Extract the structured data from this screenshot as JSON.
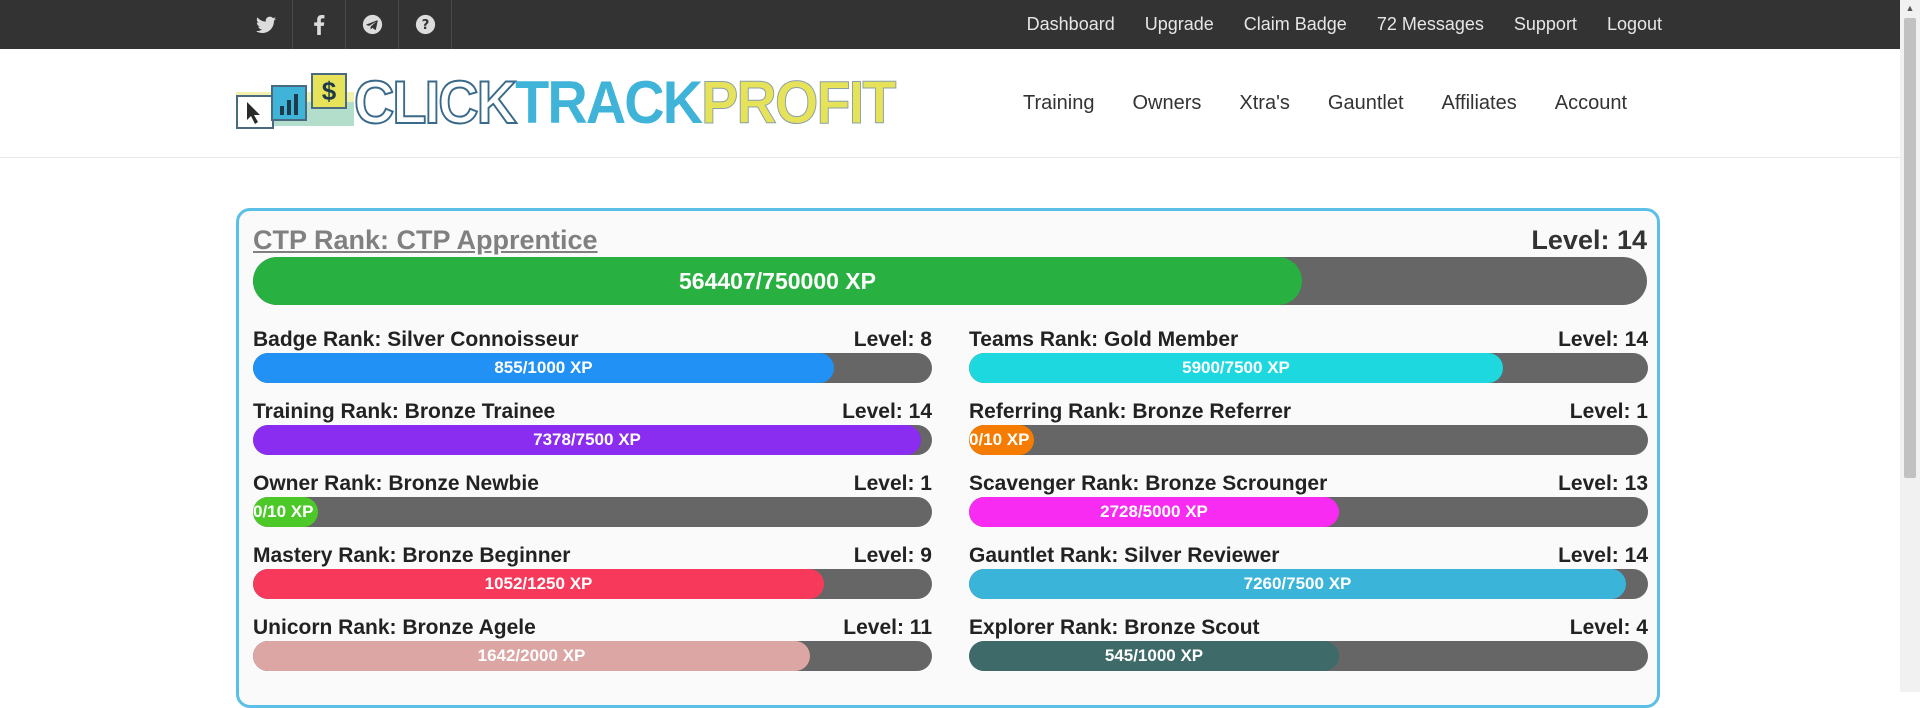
{
  "topbar": {
    "social_icons": [
      "twitter-icon",
      "facebook-icon",
      "telegram-icon",
      "help-icon"
    ],
    "nav": [
      "Dashboard",
      "Upgrade",
      "Claim Badge",
      "72 Messages",
      "Support",
      "Logout"
    ]
  },
  "header": {
    "logo": {
      "part1": "CLICK",
      "part2": "TRACK",
      "part3": "PROFIT"
    },
    "nav": [
      "Training",
      "Owners",
      "Xtra's",
      "Gauntlet",
      "Affiliates",
      "Account"
    ]
  },
  "ctp_rank": {
    "title": "CTP Rank: CTP Apprentice",
    "level": "Level: 14",
    "xp_text": "564407/750000 XP",
    "progress": 0.7525,
    "color": "#28b040"
  },
  "ranks": [
    {
      "name": "Badge Rank: Silver Connoisseur",
      "level": "Level: 8",
      "xp_text": "855/1000 XP",
      "progress": 0.855,
      "color": "#2191f5",
      "column": "left"
    },
    {
      "name": "Teams Rank: Gold Member",
      "level": "Level: 14",
      "xp_text": "5900/7500 XP",
      "progress": 0.787,
      "color": "#1ed8e0",
      "column": "right"
    },
    {
      "name": "Training Rank: Bronze Trainee",
      "level": "Level: 14",
      "xp_text": "7378/7500 XP",
      "progress": 0.984,
      "color": "#8a2df0",
      "column": "left"
    },
    {
      "name": "Referring Rank: Bronze Referrer",
      "level": "Level: 1",
      "xp_text": "0/10 XP",
      "progress": 0.0,
      "color": "#f57c00",
      "column": "right"
    },
    {
      "name": "Owner Rank: Bronze Newbie",
      "level": "Level: 1",
      "xp_text": "0/10 XP",
      "progress": 0.0,
      "color": "#4cc828",
      "column": "left"
    },
    {
      "name": "Scavenger Rank: Bronze Scrounger",
      "level": "Level: 13",
      "xp_text": "2728/5000 XP",
      "progress": 0.5456,
      "color": "#f82bf2",
      "column": "right"
    },
    {
      "name": "Mastery Rank: Bronze Beginner",
      "level": "Level: 9",
      "xp_text": "1052/1250 XP",
      "progress": 0.8416,
      "color": "#f73a5c",
      "column": "left"
    },
    {
      "name": "Gauntlet Rank: Silver Reviewer",
      "level": "Level: 14",
      "xp_text": "7260/7500 XP",
      "progress": 0.968,
      "color": "#3ab4d8",
      "column": "right"
    },
    {
      "name": "Unicorn Rank: Bronze Agele",
      "level": "Level: 11",
      "xp_text": "1642/2000 XP",
      "progress": 0.821,
      "color": "#dba6a4",
      "column": "left"
    },
    {
      "name": "Explorer Rank: Bronze Scout",
      "level": "Level: 4",
      "xp_text": "545/1000 XP",
      "progress": 0.545,
      "color": "#3e6b6a",
      "column": "right"
    }
  ]
}
